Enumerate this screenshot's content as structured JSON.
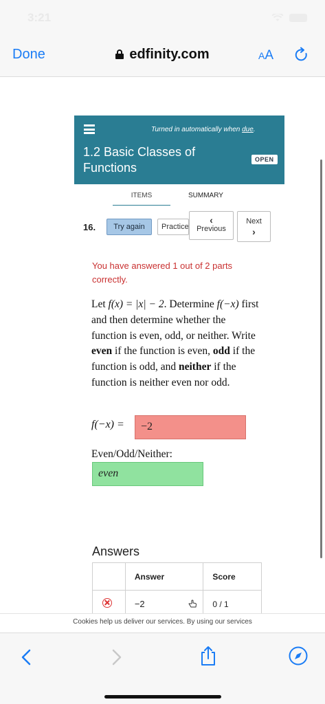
{
  "status_bar": {
    "time": "3:21"
  },
  "browser": {
    "done_label": "Done",
    "url": "edfinity.com",
    "aa_label_small": "A",
    "aa_label_large": "A"
  },
  "assignment": {
    "turned_in_prefix": "Turned in automatically when ",
    "turned_in_link": "due",
    "turned_in_suffix": ".",
    "title": "1.2 Basic Classes of Functions",
    "status_badge": "OPEN"
  },
  "tabs": {
    "items": "ITEMS",
    "summary": "SUMMARY"
  },
  "question_nav": {
    "number": "16.",
    "try_again": "Try again",
    "practice": "Practice",
    "previous": "Previous",
    "next": "Next"
  },
  "feedback": "You have answered 1 out of 2 parts correctly.",
  "problem": {
    "intro": "Let ",
    "fx": "f(x) = |x| − 2",
    "determine": ". Determine ",
    "fnx": "f(−x)",
    "rest": " first and then determine whether the function is even, odd, or neither. Write ",
    "even": "even",
    "if_even": " if the function is even, ",
    "odd": "odd",
    "if_odd": " if the function is odd, and ",
    "neither": "neither",
    "if_neither": " if the function is neither even nor odd."
  },
  "fields": {
    "f_neg_x_label": "f(−x) =",
    "f_neg_x_value": "−2",
    "eon_label": "Even/Odd/Neither:",
    "eon_value": "even"
  },
  "answers": {
    "heading": "Answers",
    "columns": [
      "",
      "Answer",
      "Score"
    ],
    "rows": [
      {
        "answer": "−2",
        "score": "0 / 1"
      }
    ]
  },
  "cookie_text": "Cookies help us deliver our services. By using our services",
  "colors": {
    "accent": "#2a7d93",
    "link": "#1a7cf5",
    "incorrect": "#f3908a",
    "correct": "#90e29f"
  }
}
